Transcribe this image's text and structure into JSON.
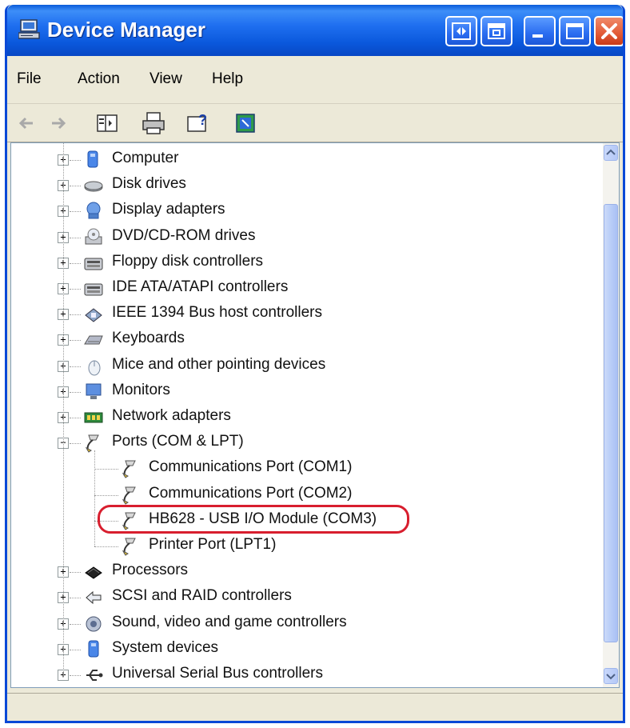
{
  "window": {
    "title": "Device Manager",
    "title_icon": "computer-monitor-icon",
    "controls": [
      "remote-assist-icon",
      "restore-window-icon",
      "minimize-icon",
      "maximize-icon",
      "close-icon"
    ]
  },
  "menu": {
    "items": [
      "File",
      "Action",
      "View",
      "Help"
    ]
  },
  "toolbar": {
    "tools": [
      "back-arrow-icon",
      "forward-arrow-icon",
      "show-hide-tree-icon",
      "print-icon",
      "help-icon",
      "properties-icon"
    ]
  },
  "tree": {
    "items": [
      {
        "label": "Computer",
        "icon": "computer-icon",
        "expanded": false
      },
      {
        "label": "Disk drives",
        "icon": "disk-drive-icon",
        "expanded": false
      },
      {
        "label": "Display adapters",
        "icon": "display-adapter-icon",
        "expanded": false
      },
      {
        "label": "DVD/CD-ROM drives",
        "icon": "dvd-drive-icon",
        "expanded": false
      },
      {
        "label": "Floppy disk controllers",
        "icon": "floppy-controller-icon",
        "expanded": false
      },
      {
        "label": "IDE ATA/ATAPI controllers",
        "icon": "ide-controller-icon",
        "expanded": false
      },
      {
        "label": "IEEE 1394 Bus host controllers",
        "icon": "ieee1394-icon",
        "expanded": false
      },
      {
        "label": "Keyboards",
        "icon": "keyboard-icon",
        "expanded": false
      },
      {
        "label": "Mice and other pointing devices",
        "icon": "mouse-icon",
        "expanded": false
      },
      {
        "label": "Monitors",
        "icon": "monitor-icon",
        "expanded": false
      },
      {
        "label": "Network adapters",
        "icon": "network-adapter-icon",
        "expanded": false
      },
      {
        "label": "Ports (COM & LPT)",
        "icon": "port-icon",
        "expanded": true,
        "children": [
          {
            "label": "Communications Port (COM1)",
            "icon": "port-icon"
          },
          {
            "label": "Communications Port (COM2)",
            "icon": "port-icon"
          },
          {
            "label": "HB628 - USB I/O Module (COM3)",
            "icon": "port-icon",
            "highlighted": true
          },
          {
            "label": "Printer Port (LPT1)",
            "icon": "port-icon"
          }
        ]
      },
      {
        "label": "Processors",
        "icon": "processor-icon",
        "expanded": false
      },
      {
        "label": "SCSI and RAID controllers",
        "icon": "scsi-controller-icon",
        "expanded": false
      },
      {
        "label": "Sound, video and game controllers",
        "icon": "sound-icon",
        "expanded": false
      },
      {
        "label": "System devices",
        "icon": "system-device-icon",
        "expanded": false
      },
      {
        "label": "Universal Serial Bus controllers",
        "icon": "usb-icon",
        "expanded": false
      }
    ]
  },
  "colors": {
    "titlebar": "#0a58dc",
    "highlight_ring": "#d81e2e",
    "window_face": "#ece9d8"
  },
  "statusbar": {
    "text": ""
  }
}
